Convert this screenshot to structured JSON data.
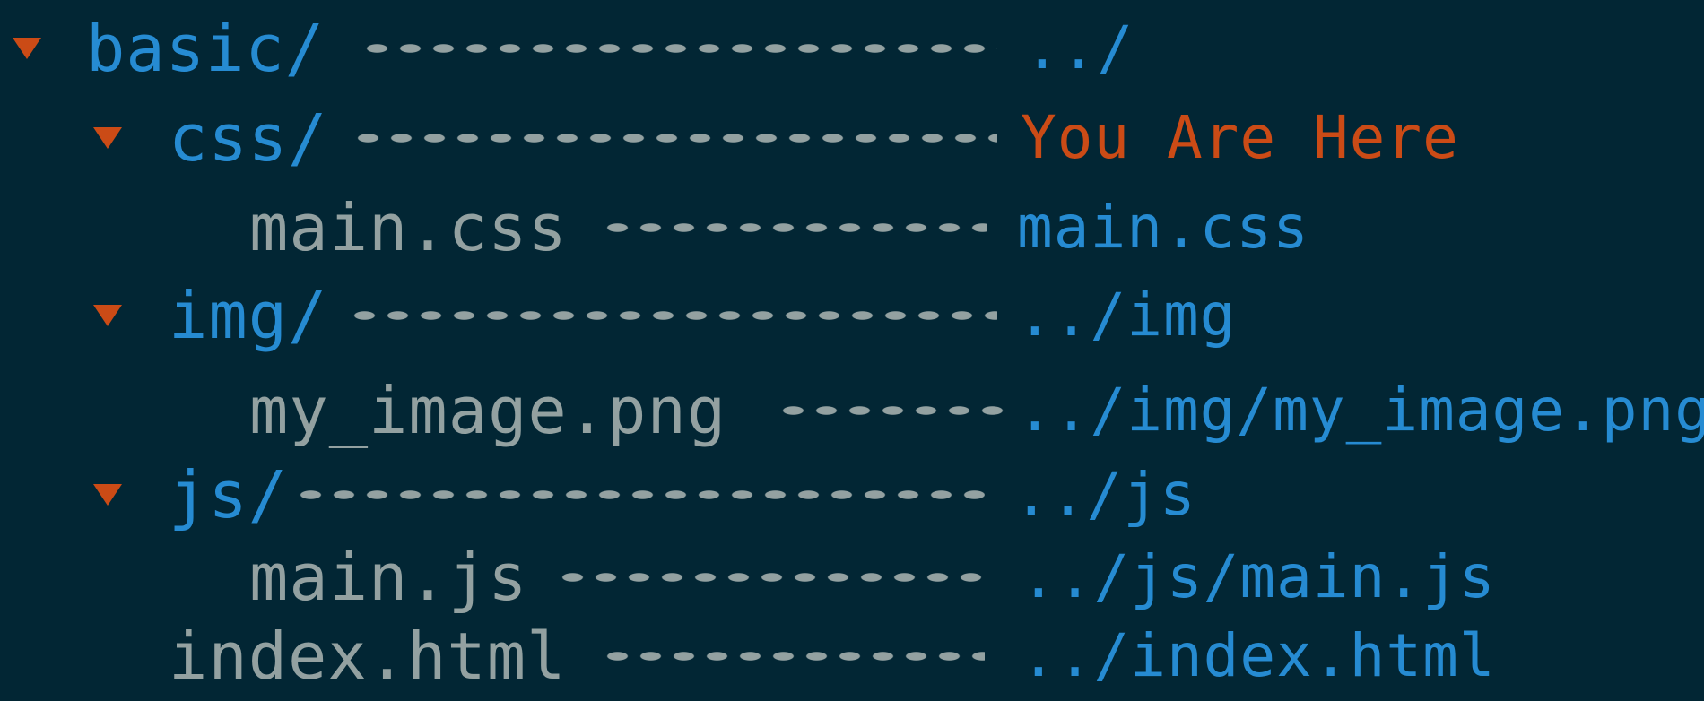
{
  "colors": {
    "background": "#022634",
    "directory": "#268bd2",
    "file": "#93a1a1",
    "highlight": "#cb4b16",
    "arrow": "#cb4b16"
  },
  "icons": {
    "expanded": "triangle-down-icon"
  },
  "tree": [
    {
      "name": "basic/",
      "kind": "dir",
      "expanded": true,
      "target": "../"
    },
    {
      "name": "css/",
      "kind": "dir",
      "expanded": true,
      "target": "You Are Here",
      "highlight": true
    },
    {
      "name": "main.css",
      "kind": "file",
      "target": "main.css"
    },
    {
      "name": "img/",
      "kind": "dir",
      "expanded": true,
      "target": "../img"
    },
    {
      "name": "my_image.png",
      "kind": "file",
      "target": "../img/my_image.png"
    },
    {
      "name": "js/",
      "kind": "dir",
      "expanded": true,
      "target": "../js"
    },
    {
      "name": "main.js",
      "kind": "file",
      "target": "../js/main.js"
    },
    {
      "name": "index.html",
      "kind": "file",
      "target": "../index.html"
    }
  ]
}
